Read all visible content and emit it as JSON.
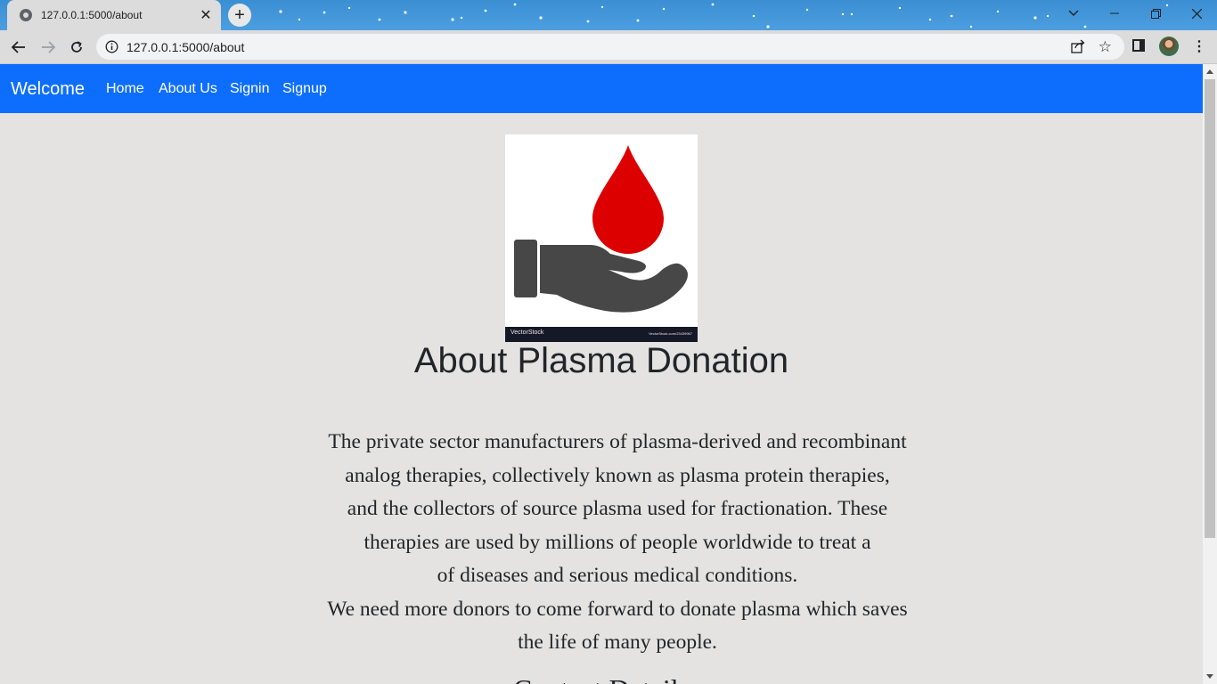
{
  "browser": {
    "tab_title": "127.0.0.1:5000/about",
    "url": "127.0.0.1:5000/about"
  },
  "navbar": {
    "brand": "Welcome",
    "links": [
      "Home",
      "About Us",
      "Signin",
      "Signup"
    ],
    "color": "#0d6efd"
  },
  "main": {
    "logo_image": {
      "icon": "blood-drop-hand-icon",
      "watermark_left": "VectorStock",
      "watermark_right": "VectorStock.com/23439967"
    },
    "title": "About Plasma Donation",
    "paragraph_lines": [
      "The private sector manufacturers of plasma-derived and recombinant",
      "analog therapies, collectively known as plasma protein therapies,",
      "and the collectors of source plasma used for fractionation. These",
      "therapies are used by millions of people worldwide to treat a",
      "of diseases and serious medical conditions.",
      "We need more donors to come forward to donate plasma which saves",
      "the life of many people."
    ],
    "next_heading": "Contact Details"
  },
  "colors": {
    "page_bg": "#e4e3e1",
    "drop_red": "#dd0000",
    "hand_gray": "#474747"
  }
}
